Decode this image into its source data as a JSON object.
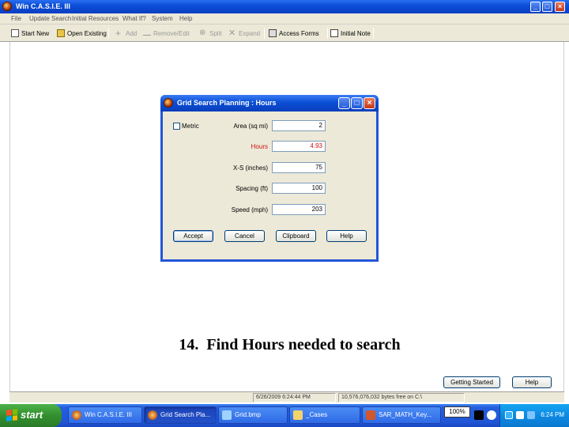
{
  "window": {
    "title": "Win C.A.S.I.E. III",
    "minimize": "_",
    "maximize": "□",
    "close": "×"
  },
  "menu": {
    "items": [
      "File",
      "Update Search",
      "Initial Resources",
      "What If?",
      "System",
      "Help"
    ]
  },
  "toolbar": {
    "items": [
      {
        "label": "Start New",
        "enabled": true,
        "icon": "new-file-icon"
      },
      {
        "label": "Open Existing",
        "enabled": true,
        "icon": "open-folder-icon"
      },
      {
        "label": "Add",
        "enabled": false,
        "icon": "add-icon"
      },
      {
        "label": "Remove/Edit",
        "enabled": false,
        "icon": "minus-icon"
      },
      {
        "label": "Split",
        "enabled": false,
        "icon": "split-icon"
      },
      {
        "label": "Expand",
        "enabled": false,
        "icon": "expand-icon"
      },
      {
        "label": "Access Forms",
        "enabled": true,
        "icon": "forms-icon"
      },
      {
        "label": "Initial Note",
        "enabled": true,
        "icon": "note-icon"
      }
    ]
  },
  "dialog": {
    "title": "Grid Search Planning : Hours",
    "metric_label": "Metric",
    "fields": [
      {
        "label": "Area (sq mi)",
        "value": "2",
        "highlight": false
      },
      {
        "label": "Hours",
        "value": "4.93",
        "highlight": true
      },
      {
        "label": "X-S (inches)",
        "value": "75",
        "highlight": false
      },
      {
        "label": "Spacing (ft)",
        "value": "100",
        "highlight": false
      },
      {
        "label": "Speed (mph)",
        "value": "203",
        "highlight": false
      }
    ],
    "buttons": [
      "Accept",
      "Cancel",
      "Clipboard",
      "Help"
    ],
    "title_buttons": {
      "minimize": "_",
      "maximize": "□",
      "close": "×"
    }
  },
  "caption": {
    "number": "14.",
    "text": "Find Hours needed to search"
  },
  "bottom_buttons": {
    "getting_started": "Getting Started",
    "help": "Help"
  },
  "status": {
    "datetime": "6/26/2009 6:24:44 PM",
    "disk": "10,576,076,032 bytes free on C:\\"
  },
  "taskbar": {
    "start": "start",
    "tasks": [
      {
        "label": "Win C.A.S.I.E. III",
        "active": false
      },
      {
        "label": "Grid Search Pla...",
        "active": true
      },
      {
        "label": "Grid.bmp",
        "active": false
      },
      {
        "label": "_Cases",
        "active": false
      },
      {
        "label": "SAR_MATH_Key...",
        "active": false
      }
    ],
    "zoom": "100%",
    "clock": "6:24 PM"
  },
  "colors": {
    "title_blue": "#0a4fd6",
    "highlight_red": "#d01010",
    "taskbar_blue": "#245edc",
    "start_green": "#338f30",
    "dialog_bg": "#ece9d8"
  }
}
